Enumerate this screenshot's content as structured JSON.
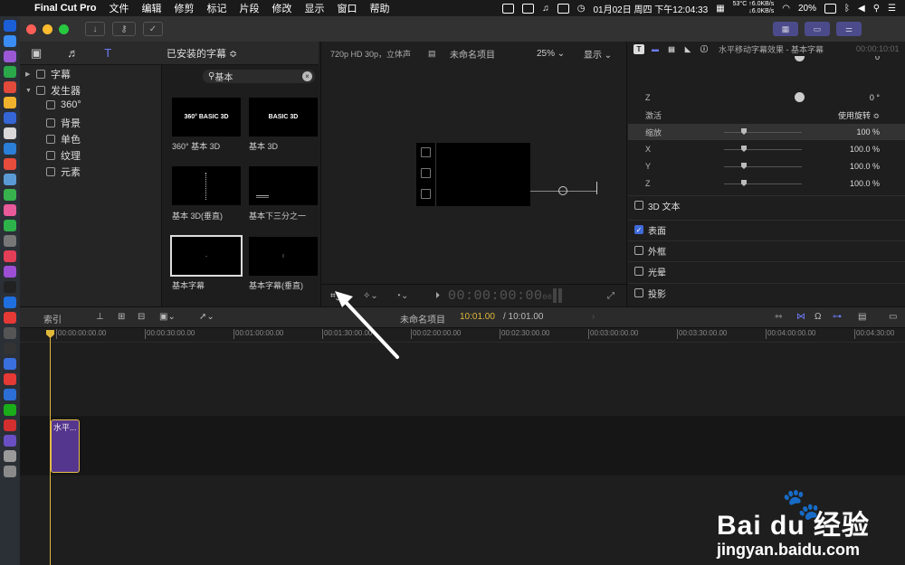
{
  "menubar": {
    "app_name": "Final Cut Pro",
    "menus": [
      "文件",
      "编辑",
      "修剪",
      "标记",
      "片段",
      "修改",
      "显示",
      "窗口",
      "帮助"
    ],
    "temperature": "53°C",
    "net_up": "↑6.0KB/s",
    "net_down": "↓6.0KB/s",
    "battery": "20%",
    "datetime": "01月02日 周四 下午12:04:33"
  },
  "library": {
    "filter_label": "已安装的字幕 ≎",
    "search_value": "基本",
    "tree": {
      "titles": "字幕",
      "generators": "发生器",
      "children": [
        "360°",
        "背景",
        "单色",
        "纹理",
        "元素"
      ]
    },
    "thumbs": [
      {
        "label": "360° 基本 3D",
        "preview": "360° BASIC 3D"
      },
      {
        "label": "基本 3D",
        "preview": "BASIC 3D"
      },
      {
        "label": "基本 3D(垂直)",
        "preview": ""
      },
      {
        "label": "基本下三分之一",
        "preview": ""
      },
      {
        "label": "基本字幕",
        "preview": ""
      },
      {
        "label": "基本字幕(垂直)",
        "preview": ""
      }
    ]
  },
  "viewer": {
    "format": "720p HD 30p，立体声",
    "project_name": "未命名项目",
    "zoom": "25% ⌄",
    "view_menu": "显示 ⌄",
    "timecode": "00:00:00:00",
    "timecode_frames": "00"
  },
  "inspector": {
    "title": "水平移动字幕效果 - 基本字幕",
    "title_time": "00:00:10:01",
    "rows": [
      {
        "label": "Z",
        "value": "0 °"
      },
      {
        "label": "激活",
        "value": "使用旋转 ≎"
      },
      {
        "label": "缩放",
        "value": "100 %"
      },
      {
        "label": "X",
        "value": "100.0 %"
      },
      {
        "label": "Y",
        "value": "100.0 %"
      },
      {
        "label": "Z",
        "value": "100.0 %"
      }
    ],
    "partial_top_value": "0",
    "sections": [
      {
        "label": "3D 文本",
        "checked": false
      },
      {
        "label": "表面",
        "checked": true
      },
      {
        "label": "外框",
        "checked": false
      },
      {
        "label": "光晕",
        "checked": false
      },
      {
        "label": "投影",
        "checked": false
      }
    ]
  },
  "timeline": {
    "index_label": "索引",
    "project_name": "未命名项目",
    "duration_current": "10:01.00",
    "duration_total": "/ 10:01.00",
    "ruler": [
      "00:00:00:00.00",
      "00:00:30:00.00",
      "00:01:00:00.00",
      "00:01:30:00.00",
      "00:02:00:00.00",
      "00:02:30:00.00",
      "00:03:00:00.00",
      "00:03:30:00.00",
      "00:04:00:00.00",
      "00:04:30:00"
    ],
    "clip_label": "水平..."
  },
  "watermark": {
    "logo": "Bai du 经验",
    "url": "jingyan.baidu.com"
  },
  "colors": {
    "accent": "#6f7cff",
    "playhead": "#e0b93b",
    "clip": "#55368e",
    "checkbox_on": "#3f6ad8"
  }
}
